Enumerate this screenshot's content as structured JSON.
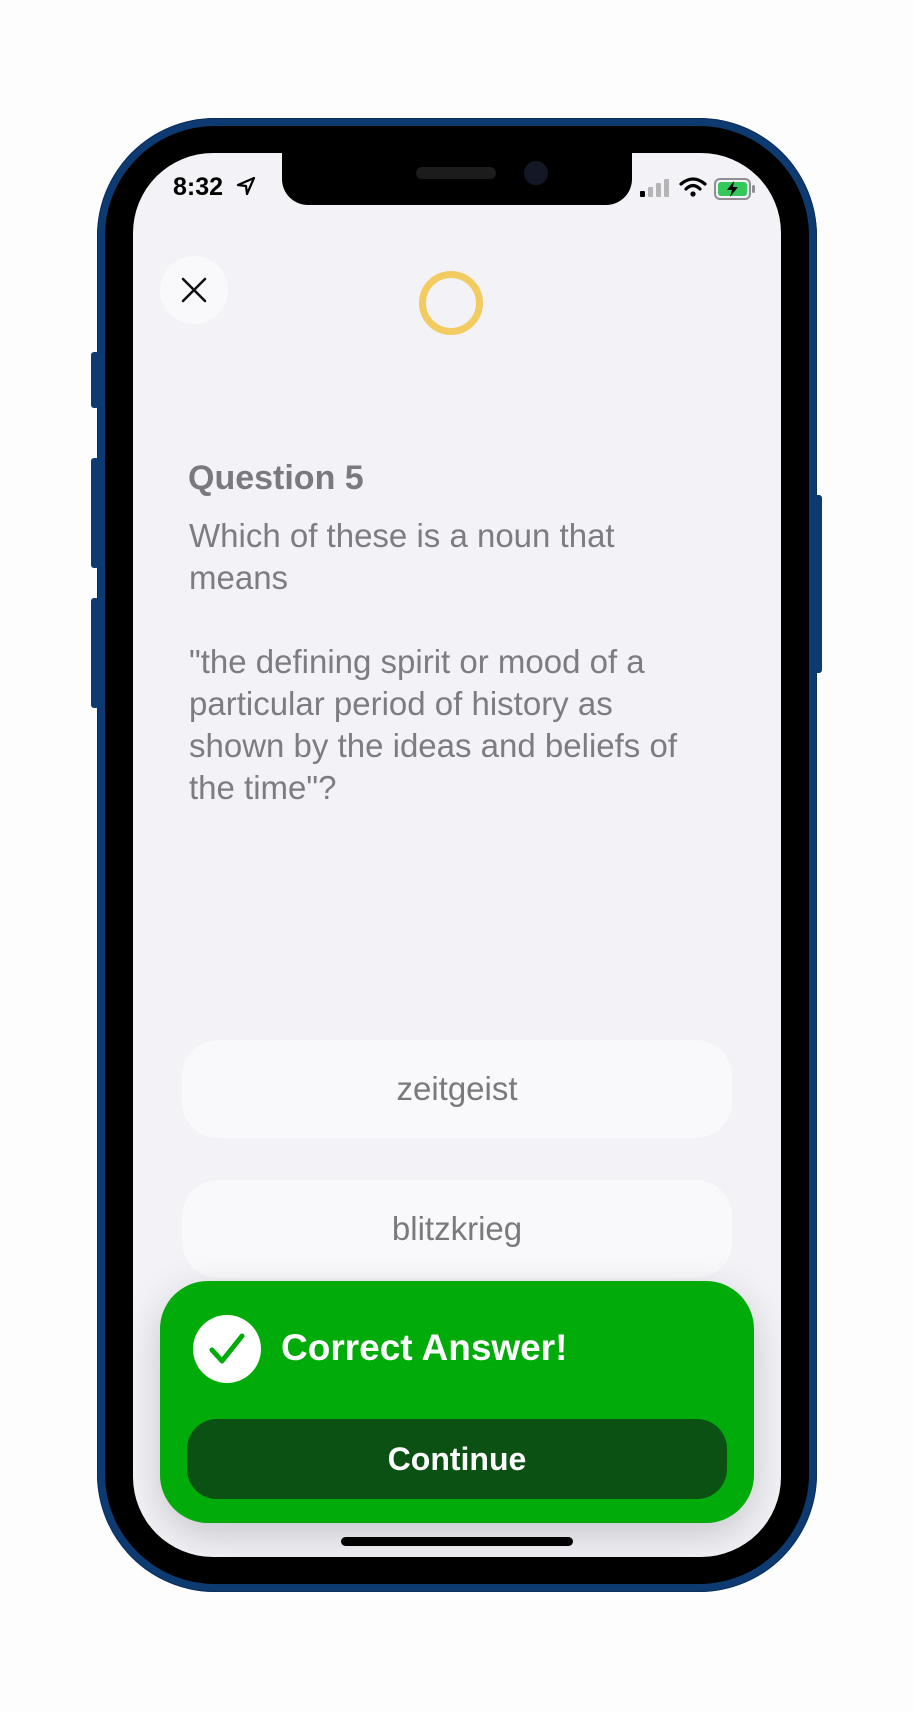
{
  "status_bar": {
    "time": "8:32",
    "icons": [
      "location-arrow-icon",
      "cellular-signal-icon",
      "wifi-icon",
      "battery-charging-icon"
    ]
  },
  "header": {
    "close_icon": "close-icon",
    "timer": {
      "icon": "timer-ring-icon",
      "color": "#f2cc60"
    }
  },
  "question": {
    "title": "Question 5",
    "text": "Which of these is a noun that means\n\n\"the defining spirit or mood of a particular period of history as shown by the ideas and beliefs of the time\"?"
  },
  "answers": [
    {
      "label": "zeitgeist"
    },
    {
      "label": "blitzkrieg"
    }
  ],
  "feedback": {
    "icon": "checkmark-icon",
    "title": "Correct Answer!",
    "continue_label": "Continue",
    "colors": {
      "panel": "#00ab0a",
      "button": "#0b5114"
    }
  }
}
